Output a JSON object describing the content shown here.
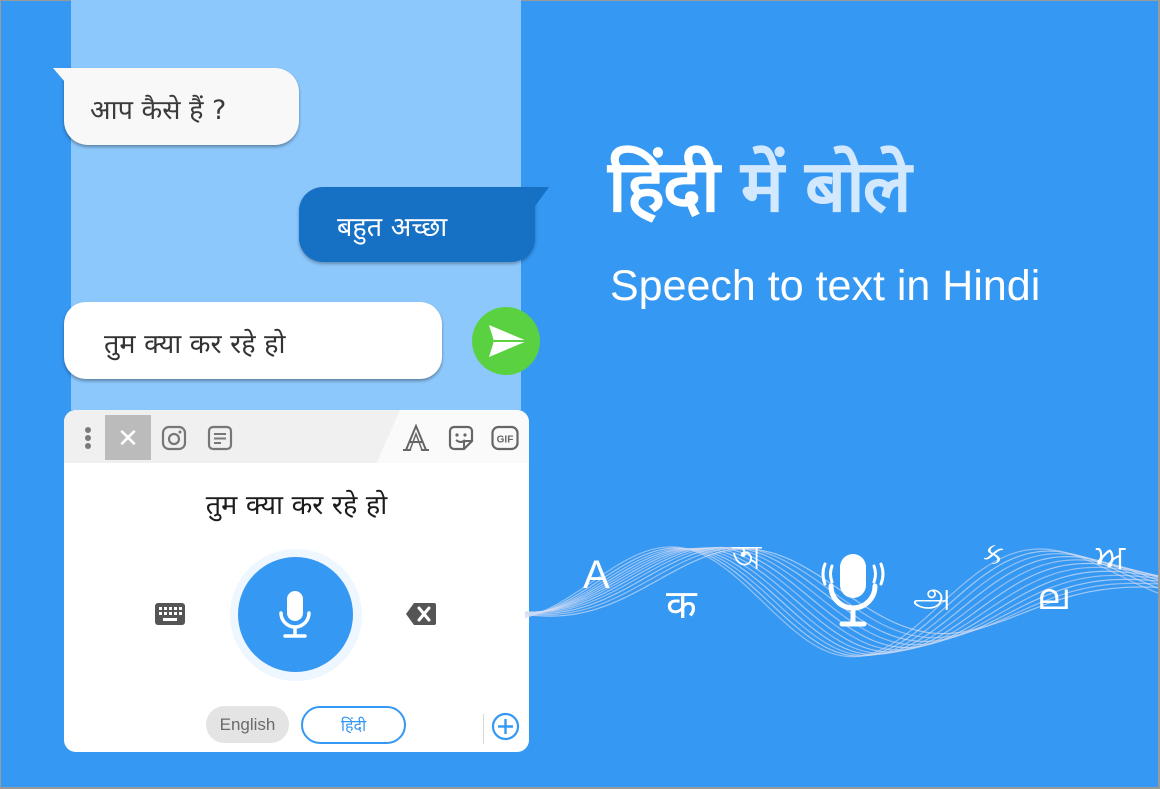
{
  "colors": {
    "background": "#3598f2",
    "chat_panel": "#8dc8fd",
    "outgoing_bubble": "#1670c4",
    "send_button": "#5ad140",
    "accent": "#3598f2",
    "headline_secondary": "#d2e8ff"
  },
  "chat": {
    "incoming_message": "आप कैसे हैं ?",
    "outgoing_message": "बहुत अच्छा",
    "compose_text": "तुम क्या कर रहे हो",
    "send_icon": "send-icon"
  },
  "keyboard": {
    "toolbar": {
      "left_icons": [
        "more-vert-icon",
        "close-icon",
        "instagram-icon",
        "clipboard-icon"
      ],
      "right_icons": [
        "font-style-icon",
        "sticker-icon",
        "gif-icon"
      ],
      "close_glyph": "✕",
      "gif_label": "GIF"
    },
    "recognized_text": "तुम क्या कर रहे हो",
    "mic_icon": "microphone-icon",
    "keyboard_icon": "keyboard-icon",
    "delete_icon": "backspace-icon",
    "languages": [
      {
        "label": "English",
        "selected": false
      },
      {
        "label": "हिंदी",
        "selected": true
      }
    ],
    "add_language_icon": "add-circle-icon"
  },
  "promo": {
    "headline_part1": "हिंदी",
    "headline_part2": "में बोले",
    "subheadline": "Speech to text in Hindi"
  },
  "decor": {
    "glyphs": {
      "latin": "A",
      "devanagari": "क",
      "bengali": "অ",
      "tamil": "அ",
      "gujarati": "ક",
      "malayalam": "ല",
      "gurmukhi": "ਅ"
    }
  }
}
